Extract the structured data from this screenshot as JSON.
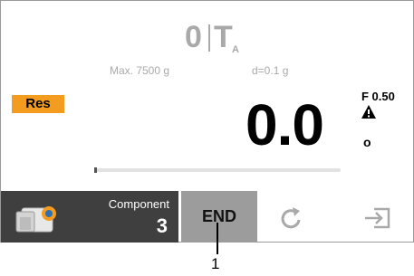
{
  "status": {
    "zero_symbol": "0",
    "tare_symbol": "T",
    "tare_subscript": "A",
    "max_capacity": "Max. 7500 g",
    "readability": "d=0.1 g"
  },
  "result_badge": "Res",
  "weight": {
    "value": "0.0",
    "filter": "F 0.50",
    "stability_mark": "o"
  },
  "progress": {
    "fraction": 0.0
  },
  "bottom_bar": {
    "component_label": "Component",
    "component_count": "3",
    "end_label": "END"
  },
  "callout": {
    "number": "1"
  },
  "colors": {
    "accent_orange": "#f39c1f",
    "dark_button": "#3f3f3f",
    "end_button": "#9c9c9c",
    "inactive_gray": "#a9a9a9"
  },
  "icons": [
    "warning-icon",
    "component-container-icon",
    "refresh-icon",
    "import-icon"
  ]
}
